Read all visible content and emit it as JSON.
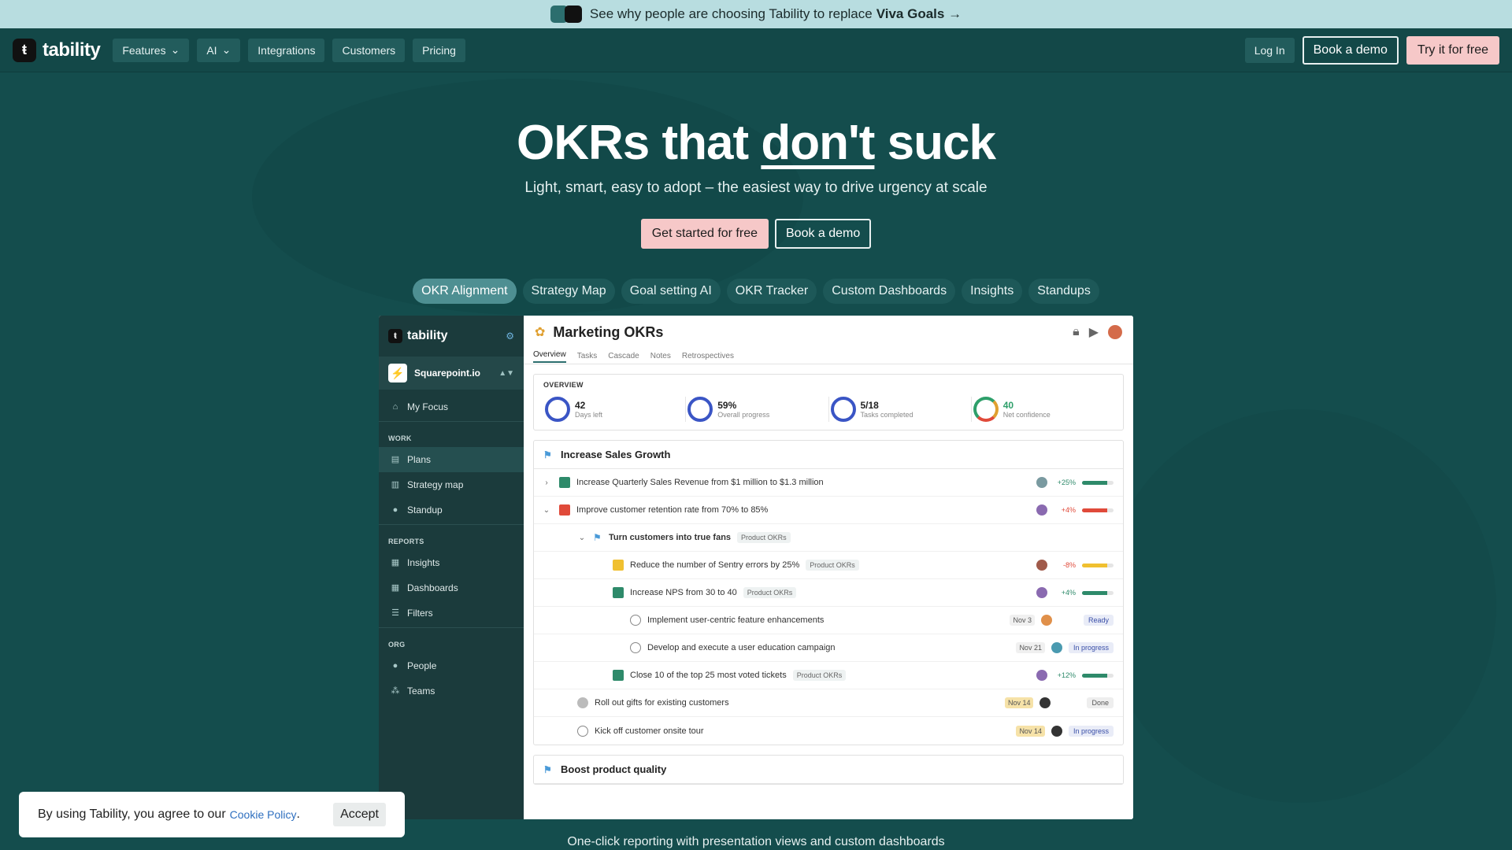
{
  "banner": {
    "text": "See why people are choosing Tability to replace",
    "bold": "Viva Goals →"
  },
  "nav": {
    "brand": "tability",
    "items": [
      "Features",
      "AI",
      "Integrations",
      "Customers",
      "Pricing"
    ],
    "login": "Log In",
    "demo": "Book a demo",
    "try": "Try it for free"
  },
  "hero": {
    "title_a": "OKRs that ",
    "title_u": "don't",
    "title_b": " suck",
    "subtitle": "Light, smart, easy to adopt – the easiest way to drive urgency at scale",
    "cta_primary": "Get started for free",
    "cta_secondary": "Book a demo"
  },
  "tabs": [
    "OKR Alignment",
    "Strategy Map",
    "Goal setting AI",
    "OKR Tracker",
    "Custom Dashboards",
    "Insights",
    "Standups"
  ],
  "app": {
    "brand": "tability",
    "workspace": "Squarepoint.io",
    "focus": "My Focus",
    "sec_work": "WORK",
    "work": [
      "Plans",
      "Strategy map",
      "Standup"
    ],
    "sec_reports": "REPORTS",
    "reports": [
      "Insights",
      "Dashboards",
      "Filters"
    ],
    "sec_org": "ORG",
    "org": [
      "People",
      "Teams"
    ],
    "title": "Marketing OKRs",
    "tabs": [
      "Overview",
      "Tasks",
      "Cascade",
      "Notes",
      "Retrospectives"
    ],
    "overview_label": "OVERVIEW",
    "stats": [
      {
        "num": "42",
        "lab": "Days left"
      },
      {
        "num": "59%",
        "lab": "Overall progress"
      },
      {
        "num": "5/18",
        "lab": "Tasks completed"
      },
      {
        "num": "40",
        "lab": "Net confidence"
      }
    ],
    "objective1": "Increase Sales Growth",
    "rows": [
      {
        "text": "Increase Quarterly Sales Revenue from $1 million to $1.3 million",
        "pct": "+25%"
      },
      {
        "text": "Improve customer retention rate from 70% to 85%",
        "pct": "+4%"
      },
      {
        "text": "Turn customers into true fans",
        "chip": "Product OKRs"
      },
      {
        "text": "Reduce the number of Sentry errors by 25%",
        "chip": "Product OKRs",
        "pct": "-8%"
      },
      {
        "text": "Increase NPS from 30 to 40",
        "chip": "Product OKRs",
        "pct": "+4%"
      },
      {
        "text": "Implement user-centric feature enhancements",
        "date": "Nov 3",
        "status": "Ready"
      },
      {
        "text": "Develop and execute a user education campaign",
        "date": "Nov 21",
        "status": "In progress"
      },
      {
        "text": "Close 10 of the top 25 most voted tickets",
        "chip": "Product OKRs",
        "pct": "+12%"
      },
      {
        "text": "Roll out gifts for existing customers",
        "date": "Nov 14",
        "status": "Done"
      },
      {
        "text": "Kick off customer onsite tour",
        "date": "Nov 14",
        "status": "In progress"
      }
    ],
    "objective2": "Boost product quality"
  },
  "bottom_text": "One-click reporting with presentation views and custom dashboards",
  "cookie": {
    "text": "By using Tability, you agree to our",
    "link": "Cookie Policy",
    "period": ".",
    "accept": "Accept"
  }
}
